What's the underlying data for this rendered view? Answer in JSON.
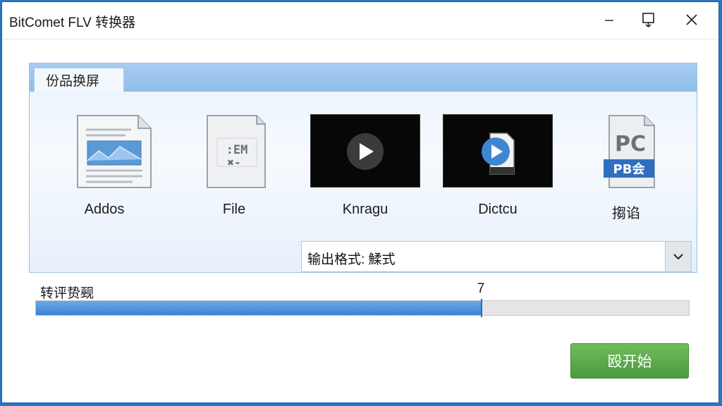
{
  "window": {
    "title": "BitComet FLV 转换器"
  },
  "panel": {
    "tab_label": "份品换屏",
    "items": [
      {
        "label": "Addos",
        "icon": "document-image-icon"
      },
      {
        "label": "File",
        "icon": "document-file-icon"
      },
      {
        "label": "Knragu",
        "icon": "video-thumbnail-play-icon"
      },
      {
        "label": "Dictcu",
        "icon": "video-thumbnail-file-icon"
      },
      {
        "label": "搊谄",
        "icon": "pc-pb-file-icon"
      }
    ],
    "output_format": {
      "text": "输出格式: 鰇式"
    }
  },
  "progress": {
    "label": "转评贽觋",
    "value_text": "7",
    "fraction": 0.682
  },
  "actions": {
    "start_label": "殴开始"
  },
  "colors": {
    "window_border": "#2a76c6",
    "progress_fill": "#4a90dc",
    "start_button": "#5aa84a",
    "panel_header": "#9cc6ee"
  }
}
